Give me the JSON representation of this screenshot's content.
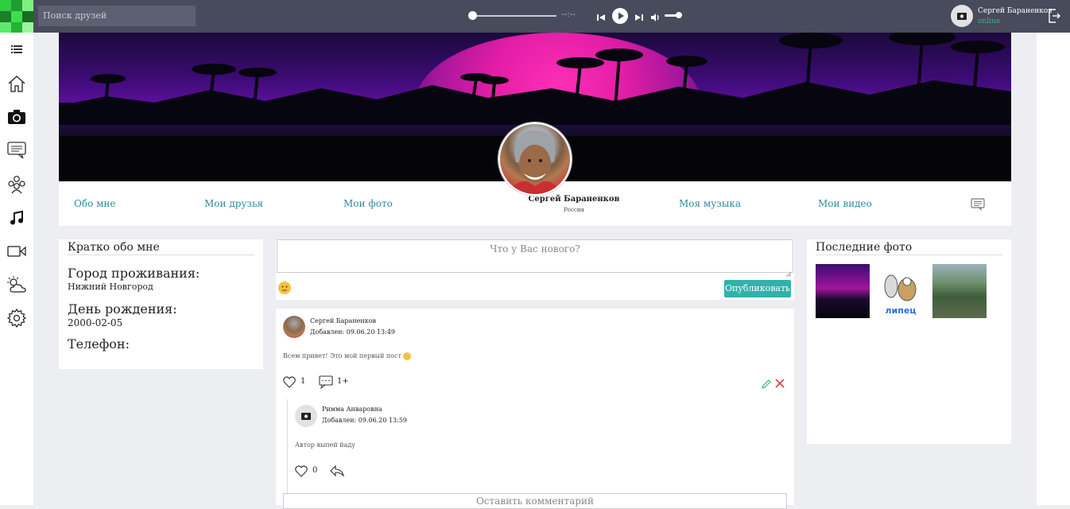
{
  "topbar": {
    "search_placeholder": "Поиск друзей",
    "player": {
      "time": "--:--",
      "progress": 0
    },
    "user": {
      "name": "Сергей Бараненков",
      "status": "online"
    }
  },
  "sidebar": {
    "items": [
      "menu-icon",
      "home-icon",
      "camera-icon",
      "messages-icon",
      "friends-icon",
      "music-icon",
      "video-icon",
      "weather-icon",
      "settings-icon"
    ]
  },
  "profile": {
    "name": "Сергей Бараненков",
    "country": "Россия",
    "nav": {
      "about": "Обо мне",
      "friends": "Мои друзья",
      "photos": "Мои фото",
      "music": "Моя музыка",
      "videos": "Мои видео"
    }
  },
  "about": {
    "title": "Кратко обо мне",
    "city_label": "Город проживания:",
    "city_value": "Нижний Новгород",
    "birthday_label": "День рождения:",
    "birthday_value": "2000-02-05",
    "phone_label": "Телефон:"
  },
  "composer": {
    "placeholder": "Что у Вас нового?",
    "publish_label": "Опубликовать"
  },
  "post": {
    "author": "Сергей Бараненков",
    "date": "Добавлен: 09.06.20 13:49",
    "text": "Всем привет! Это мой первый пост",
    "likes": "1",
    "comments": "1+",
    "comment": {
      "author": "Римма Анваровна",
      "date": "Добавлен: 09.06.20 13:59",
      "text": "Автор выпей йаду",
      "likes": "0"
    },
    "comment_input_placeholder": "Оставить комментарий"
  },
  "photos": {
    "title": "Последние фото",
    "sticker_text": "липец"
  },
  "colors": {
    "topbar": "#474b5c",
    "accent": "#2fb3a8",
    "link": "#2a8ba0",
    "delete": "#e0424a",
    "edit": "#3db86b"
  }
}
